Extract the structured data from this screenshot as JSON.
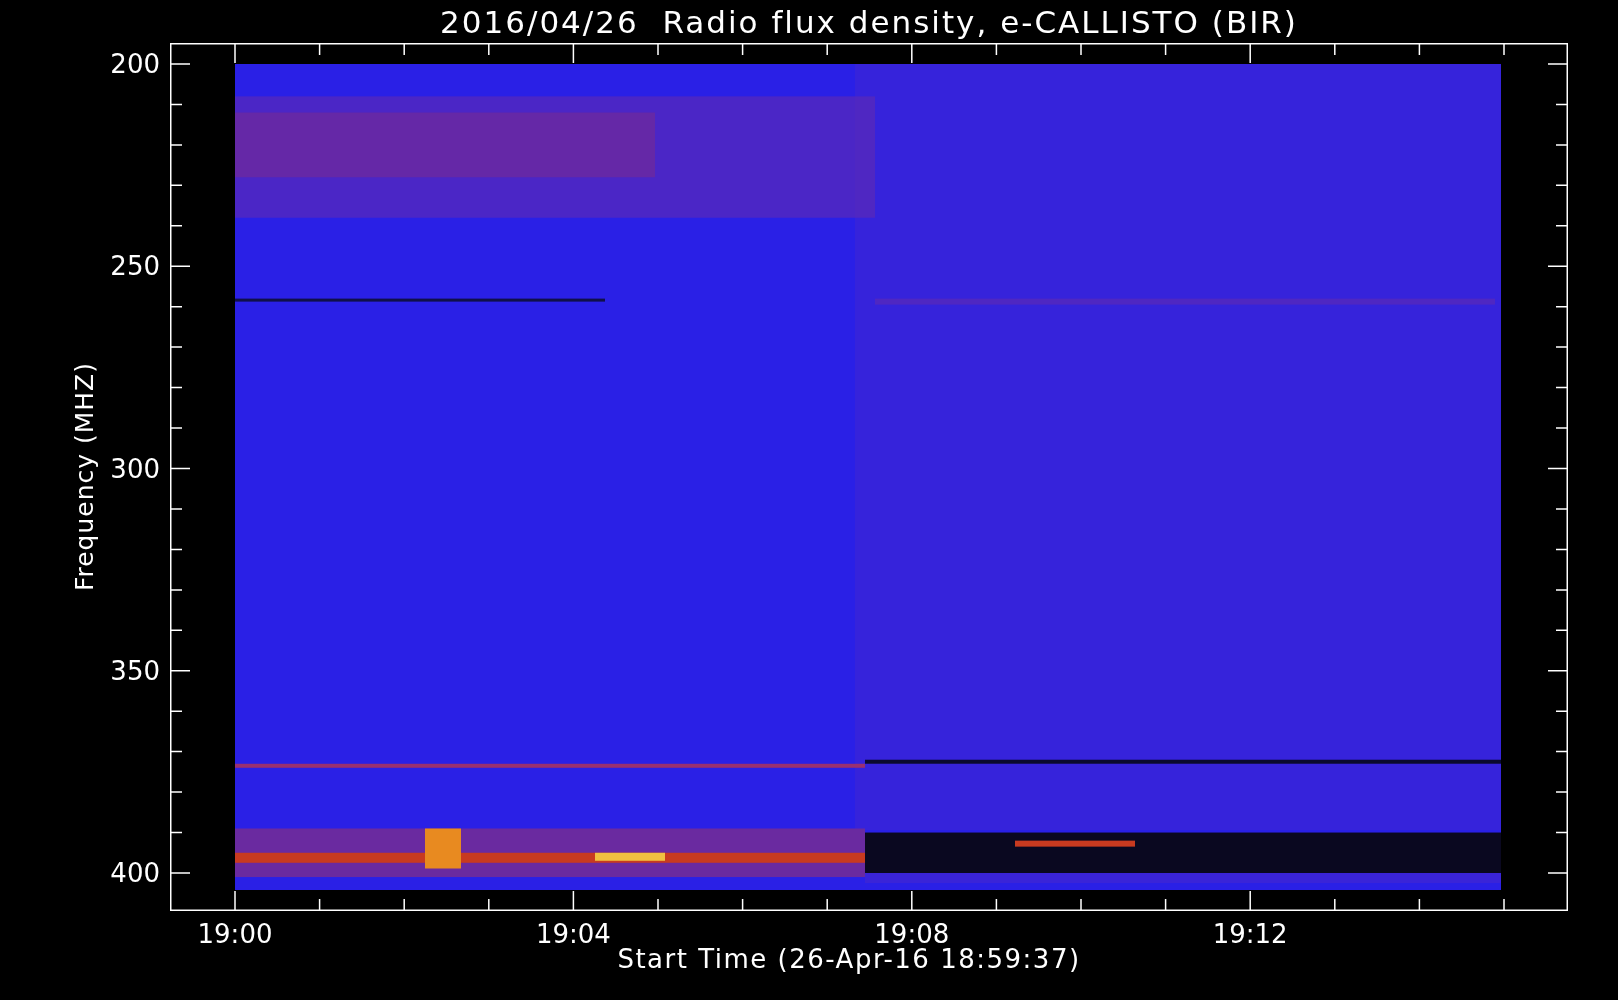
{
  "title": "2016/04/26  Radio flux density, e-CALLISTO (BIR)",
  "ylabel": "Frequency (MHZ)",
  "yticks": [
    "200",
    "250",
    "300",
    "350",
    "400"
  ],
  "xticks": [
    "19:00",
    "19:04",
    "19:08",
    "19:12"
  ],
  "xlabel": "Start Time (26-Apr-16 18:59:37)"
}
